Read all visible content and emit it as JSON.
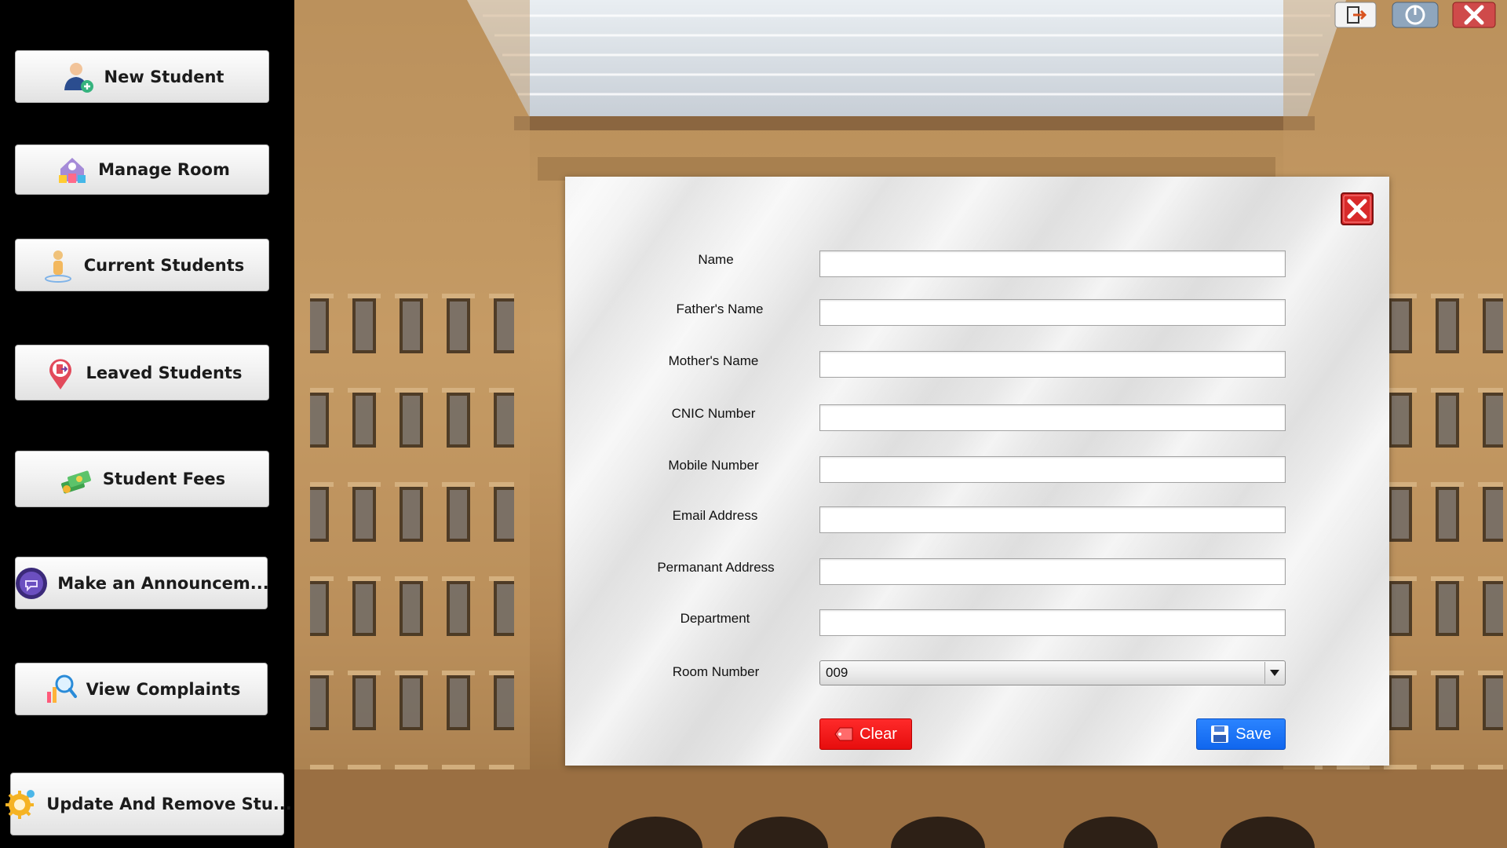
{
  "sidebar": {
    "items": [
      {
        "label": "New Student",
        "icon": "add-user-icon"
      },
      {
        "label": "Manage Room",
        "icon": "room-icon"
      },
      {
        "label": "Current Students",
        "icon": "person-icon"
      },
      {
        "label": "Leaved Students",
        "icon": "exit-pin-icon"
      },
      {
        "label": "Student Fees",
        "icon": "money-icon"
      },
      {
        "label": "Make an Announcem...",
        "icon": "announcement-icon"
      },
      {
        "label": "View Complaints",
        "icon": "complaints-search-icon"
      },
      {
        "label": "Update And Remove Stu...",
        "icon": "settings-icon"
      }
    ]
  },
  "window_controls": {
    "logout_icon": "logout-icon",
    "power_icon": "power-icon",
    "close_icon": "close-icon"
  },
  "form": {
    "fields": [
      {
        "label": "Name",
        "value": ""
      },
      {
        "label": "Father's Name",
        "value": ""
      },
      {
        "label": "Mother's Name",
        "value": ""
      },
      {
        "label": "CNIC Number",
        "value": ""
      },
      {
        "label": "Mobile Number",
        "value": ""
      },
      {
        "label": "Email Address",
        "value": ""
      },
      {
        "label": "Permanant Address",
        "value": ""
      },
      {
        "label": "Department",
        "value": ""
      }
    ],
    "room_number": {
      "label": "Room Number",
      "value": "009"
    },
    "clear_label": "Clear",
    "save_label": "Save"
  },
  "colors": {
    "clear": "#ff1a1a",
    "save": "#1a73f5",
    "close": "#d82a2a"
  }
}
